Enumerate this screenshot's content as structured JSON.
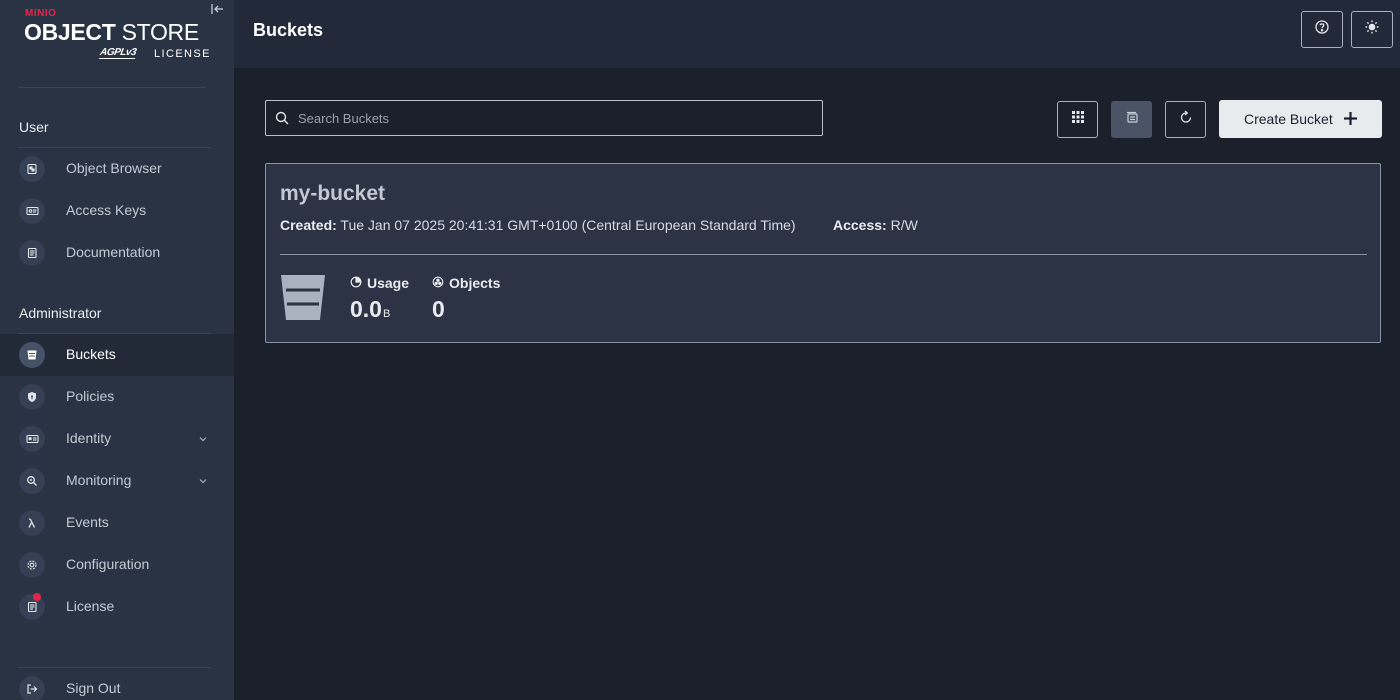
{
  "logo": {
    "brand": "MINIO",
    "product_bold": "OBJECT",
    "product_rest": " STORE",
    "agpl": "AGPLv3",
    "license_word": "LICENSE"
  },
  "sidebar": {
    "user_section": "User",
    "user_items": [
      {
        "label": "Object Browser",
        "icon": "object-browser-icon"
      },
      {
        "label": "Access Keys",
        "icon": "access-keys-icon"
      },
      {
        "label": "Documentation",
        "icon": "documentation-icon"
      }
    ],
    "admin_section": "Administrator",
    "admin_items": [
      {
        "label": "Buckets",
        "icon": "bucket-icon",
        "active": true
      },
      {
        "label": "Policies",
        "icon": "shield-icon"
      },
      {
        "label": "Identity",
        "icon": "id-card-icon",
        "expandable": true
      },
      {
        "label": "Monitoring",
        "icon": "magnifier-icon",
        "expandable": true
      },
      {
        "label": "Events",
        "icon": "lambda-icon"
      },
      {
        "label": "Configuration",
        "icon": "gear-icon"
      },
      {
        "label": "License",
        "icon": "license-icon",
        "notification": true
      }
    ],
    "sign_out": "Sign Out"
  },
  "header": {
    "title": "Buckets"
  },
  "toolbar": {
    "search_placeholder": "Search Buckets",
    "create_label": "Create Bucket"
  },
  "bucket": {
    "name": "my-bucket",
    "created_label": "Created:",
    "created_value": " Tue Jan 07 2025 20:41:31 GMT+0100 (Central European Standard Time)",
    "access_label": "Access:",
    "access_value": " R/W",
    "usage_label": "Usage",
    "usage_value": "0.0",
    "usage_unit": "B",
    "objects_label": "Objects",
    "objects_value": "0"
  },
  "colors": {
    "accent_red": "#e3254c",
    "sidebar_bg": "#2a3344",
    "main_bg": "#1b202b",
    "card_bg": "#2b3345"
  }
}
